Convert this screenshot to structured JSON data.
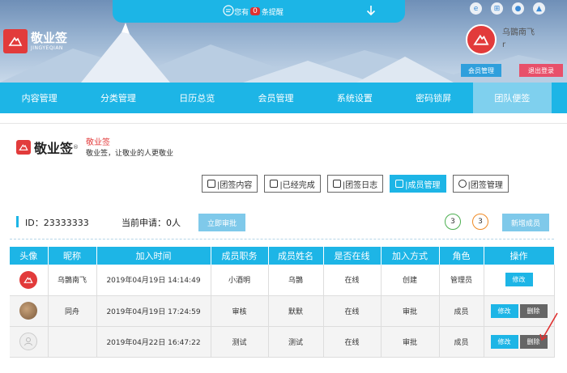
{
  "header": {
    "notice_prefix": "您有",
    "notice_count": "0",
    "notice_suffix": "条提醒",
    "brand_name": "敬业签",
    "brand_sub": "JINGYEQIAN",
    "user_name": "乌鵲南飞",
    "user_id": "r",
    "member_btn": "会员管理",
    "logout_btn": "退出登录"
  },
  "nav": [
    "内容管理",
    "分类管理",
    "日历总览",
    "会员管理",
    "系统设置",
    "密码锁屏",
    "团队便签"
  ],
  "intro": {
    "logo_text": "敬业签",
    "reg": "®",
    "title": "敬业签",
    "subtitle": "敬业签，让敬业的人更敬业"
  },
  "toolbar": [
    "|团签内容",
    "|已经完成",
    "|团签日志",
    "|成员管理",
    "|团签管理"
  ],
  "info": {
    "id_text": "ID：23333333",
    "apply_text": "当前申请：0人",
    "approve_btn": "立即审批",
    "green_count": "3",
    "orange_count": "3",
    "new_btn": "新增成员"
  },
  "table": {
    "headers": [
      "头像",
      "昵称",
      "加入时间",
      "成员职务",
      "成员姓名",
      "是否在线",
      "加入方式",
      "角色",
      "操作"
    ],
    "rows": [
      {
        "nick": "乌鵲南飞",
        "time": "2019年04月19日 14:14:49",
        "job": "小酒明",
        "name": "乌鵲",
        "online": "在线",
        "method": "创建",
        "role": "管理员",
        "edit": "修改",
        "del": ""
      },
      {
        "nick": "同舟",
        "time": "2019年04月19日 17:24:59",
        "job": "审核",
        "name": "默默",
        "online": "在线",
        "method": "审批",
        "role": "成员",
        "edit": "修改",
        "del": "删除"
      },
      {
        "nick": "",
        "time": "2019年04月22日 16:47:22",
        "job": "测试",
        "name": "测试",
        "online": "在线",
        "method": "审批",
        "role": "成员",
        "edit": "修改",
        "del": "删除"
      }
    ]
  },
  "colors": {
    "accent": "#1db5e6",
    "brand_red": "#e23b3b"
  }
}
